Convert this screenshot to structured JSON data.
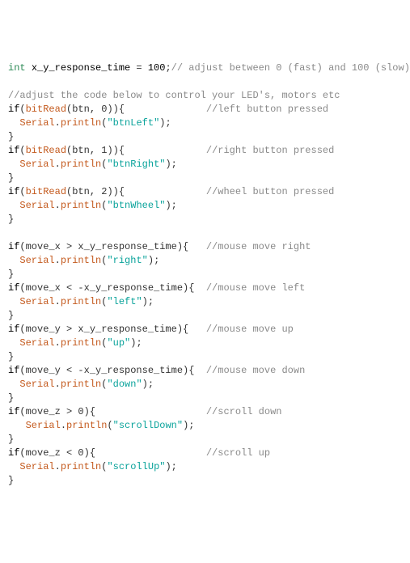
{
  "decl": {
    "type": "int",
    "name": "x_y_response_time",
    "eq": " = ",
    "val": "100",
    "semi": ";",
    "cmt": "// adjust between 0 (fast) and 100 (slow)"
  },
  "blank1": "",
  "topcmt": "//adjust the code below to control your LED's, motors etc",
  "b1": {
    "ifkw": "if",
    "open": "(",
    "fn": "bitRead",
    "args": "(btn, 0)",
    "close": "){",
    "pad": "              ",
    "cmt": "//left button pressed",
    "ind": "  ",
    "obj": "Serial",
    "dot": ".",
    "m": "println",
    "po": "(",
    "s": "\"btnLeft\"",
    "pc": ");",
    "end": "}"
  },
  "b2": {
    "ifkw": "if",
    "open": "(",
    "fn": "bitRead",
    "args": "(btn, 1)",
    "close": "){",
    "pad": "              ",
    "cmt": "//right button pressed",
    "ind": "  ",
    "obj": "Serial",
    "dot": ".",
    "m": "println",
    "po": "(",
    "s": "\"btnRight\"",
    "pc": ");",
    "end": "}"
  },
  "b3": {
    "ifkw": "if",
    "open": "(",
    "fn": "bitRead",
    "args": "(btn, 2)",
    "close": "){",
    "pad": "              ",
    "cmt": "//wheel button pressed",
    "ind": "  ",
    "obj": "Serial",
    "dot": ".",
    "m": "println",
    "po": "(",
    "s": "\"btnWheel\"",
    "pc": ");",
    "end": "}"
  },
  "blank2": "",
  "b4": {
    "ifkw": "if",
    "cond": "(move_x > x_y_response_time){",
    "pad": "   ",
    "cmt": "//mouse move right",
    "ind": "  ",
    "obj": "Serial",
    "dot": ".",
    "m": "println",
    "po": "(",
    "s": "\"right\"",
    "pc": ");",
    "end": "}"
  },
  "b5": {
    "ifkw": "if",
    "cond": "(move_x < -x_y_response_time){",
    "pad": "  ",
    "cmt": "//mouse move left",
    "ind": "  ",
    "obj": "Serial",
    "dot": ".",
    "m": "println",
    "po": "(",
    "s": "\"left\"",
    "pc": ");",
    "end": "}"
  },
  "b6": {
    "ifkw": "if",
    "cond": "(move_y > x_y_response_time){",
    "pad": "   ",
    "cmt": "//mouse move up",
    "ind": "  ",
    "obj": "Serial",
    "dot": ".",
    "m": "println",
    "po": "(",
    "s": "\"up\"",
    "pc": ");",
    "end": "}"
  },
  "b7": {
    "ifkw": "if",
    "cond": "(move_y < -x_y_response_time){",
    "pad": "  ",
    "cmt": "//mouse move down",
    "ind": "  ",
    "obj": "Serial",
    "dot": ".",
    "m": "println",
    "po": "(",
    "s": "\"down\"",
    "pc": ");",
    "end": "}"
  },
  "b8": {
    "ifkw": "if",
    "cond": "(move_z > 0){",
    "pad": "                   ",
    "cmt": "//scroll down",
    "ind": "   ",
    "obj": "Serial",
    "dot": ".",
    "m": "println",
    "po": "(",
    "s": "\"scrollDown\"",
    "pc": ");",
    "end": "}"
  },
  "b9": {
    "ifkw": "if",
    "cond": "(move_z < 0){",
    "pad": "                   ",
    "cmt": "//scroll up",
    "ind": "  ",
    "obj": "Serial",
    "dot": ".",
    "m": "println",
    "po": "(",
    "s": "\"scrollUp\"",
    "pc": ");",
    "end": "}"
  }
}
